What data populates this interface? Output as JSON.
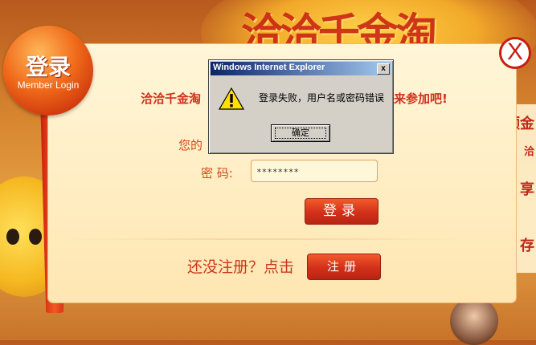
{
  "login_panel": {
    "badge_title": "登录",
    "badge_subtitle": "Member Login",
    "close_glyph": "X",
    "welcome_left": "洽洽千金淘",
    "welcome_right": "来参加吧!",
    "username_label_partial": "您的",
    "password_label": "密 码:",
    "password_value": "********",
    "login_button": "登录",
    "register_prompt": "还没注册？点击",
    "register_button": "注册"
  },
  "background": {
    "side_texts": [
      "领金",
      "洽",
      "享",
      "存"
    ]
  },
  "dialog": {
    "title": "Windows Internet Explorer",
    "close_glyph": "x",
    "message": "登录失败，用户名或密码错误",
    "ok_button": "确定",
    "icon": "warning-icon"
  },
  "colors": {
    "brand_red": "#c81e12",
    "button_orange": "#f25a2a",
    "panel_bg": "#fff6d8",
    "dialog_title_blue": "#0a246a"
  }
}
